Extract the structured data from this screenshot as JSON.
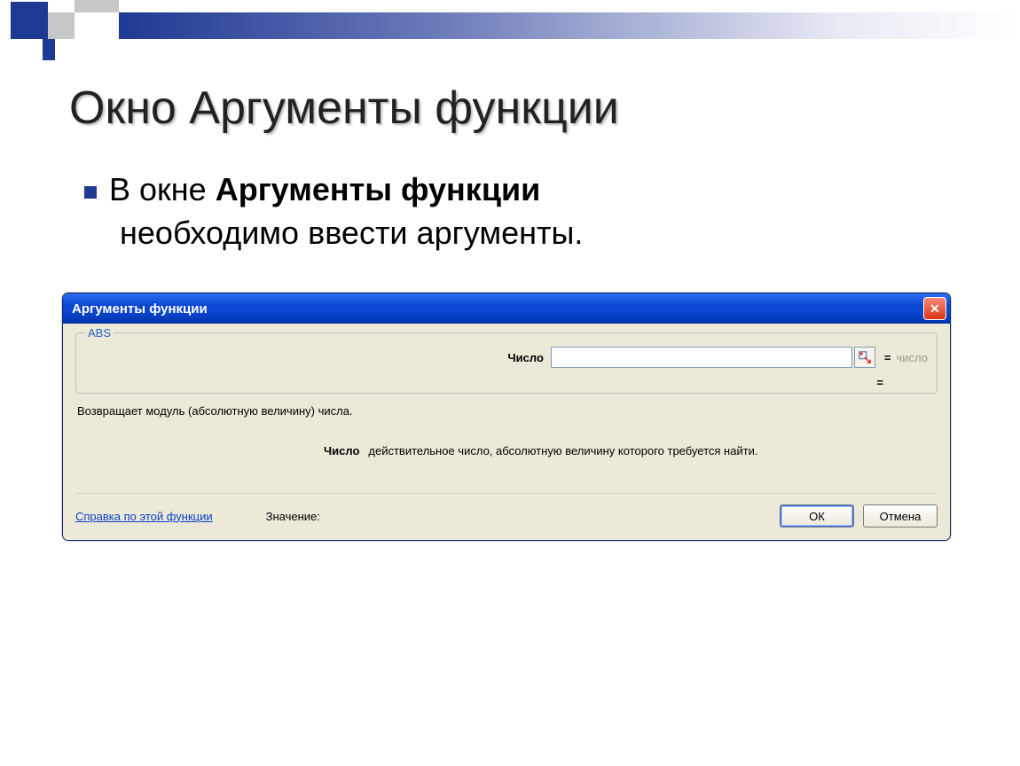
{
  "slide": {
    "title": "Окно Аргументы функции",
    "body_prefix": "В окне ",
    "body_bold": "Аргументы функции",
    "body_suffix": " необходимо ввести аргументы."
  },
  "dialog": {
    "title": "Аргументы функции",
    "close_glyph": "✕",
    "group_legend": "ABS",
    "arg_label": "Число",
    "arg_value": "",
    "result_prefix": "=",
    "result_ghost": "число",
    "eq_alone": "=",
    "description": "Возвращает модуль (абсолютную величину) числа.",
    "arg_name": "Число",
    "arg_help": "действительное число, абсолютную величину которого требуется найти.",
    "help_link": "Справка по этой функции",
    "value_label": "Значение:",
    "ok": "ОК",
    "cancel": "Отмена"
  }
}
